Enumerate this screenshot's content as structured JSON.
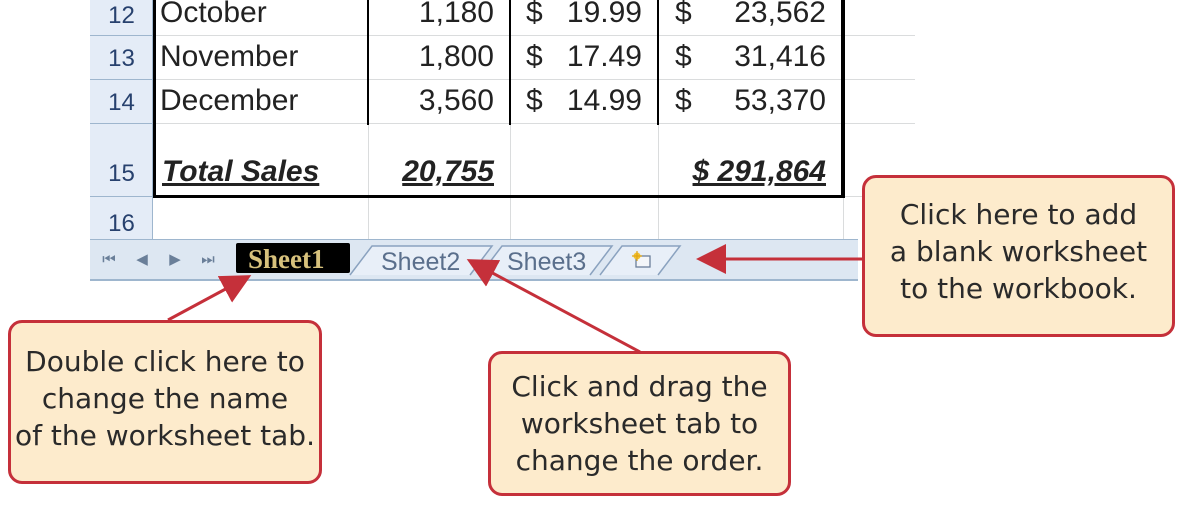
{
  "rows": [
    {
      "row": "12",
      "month": "October",
      "units": "1,180",
      "price_sym": "$",
      "price": "19.99",
      "sales_sym": "$",
      "sales": "23,562"
    },
    {
      "row": "13",
      "month": "November",
      "units": "1,800",
      "price_sym": "$",
      "price": "17.49",
      "sales_sym": "$",
      "sales": "31,416"
    },
    {
      "row": "14",
      "month": "December",
      "units": "3,560",
      "price_sym": "$",
      "price": "14.99",
      "sales_sym": "$",
      "sales": "53,370"
    }
  ],
  "total_row": {
    "row": "15",
    "label": "Total Sales",
    "units": "20,755",
    "sales": "$ 291,864"
  },
  "empty_row": {
    "row": "16"
  },
  "tabs": {
    "nav": {
      "first": "⏮",
      "prev": "◀",
      "next": "▶",
      "last": "⏭"
    },
    "sheet1": "Sheet1",
    "sheet2": "Sheet2",
    "sheet3": "Sheet3",
    "insert_icon": "insert-worksheet-icon"
  },
  "callouts": {
    "add_sheet": [
      "Click here to add",
      "a blank worksheet",
      "to the workbook."
    ],
    "rename": [
      "Double click here to",
      "change the name",
      "of the worksheet tab."
    ],
    "reorder": [
      "Click and drag the",
      "worksheet tab to",
      "change the order."
    ]
  },
  "colors": {
    "callout_border": "#c5303a",
    "callout_fill": "#fdebcc",
    "active_tab": "#000000",
    "active_tab_text": "#d7c17c"
  }
}
